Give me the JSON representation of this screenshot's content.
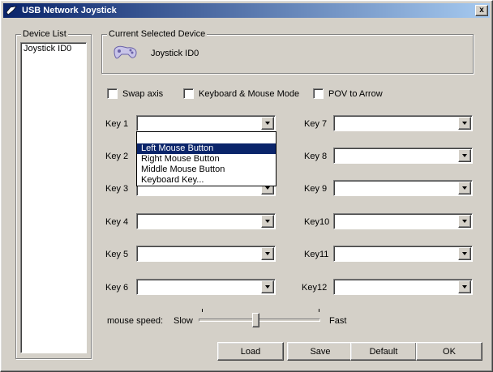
{
  "window": {
    "title": "USB Network Joystick",
    "close_glyph": "x"
  },
  "device_list": {
    "label": "Device List",
    "items": [
      "Joystick ID0"
    ]
  },
  "current_device": {
    "label": "Current Selected Device",
    "name": "Joystick ID0",
    "icon": "gamepad-icon"
  },
  "options": {
    "swap_axis": {
      "label": "Swap axis",
      "checked": false
    },
    "keyboard_mouse_mode": {
      "label": "Keyboard & Mouse Mode",
      "checked": false
    },
    "pov_to_arrow": {
      "label": "POV to Arrow",
      "checked": false
    }
  },
  "keys": {
    "k1": {
      "label": "Key 1",
      "value": ""
    },
    "k2": {
      "label": "Key 2",
      "value": ""
    },
    "k3": {
      "label": "Key 3",
      "value": ""
    },
    "k4": {
      "label": "Key 4",
      "value": ""
    },
    "k5": {
      "label": "Key 5",
      "value": ""
    },
    "k6": {
      "label": "Key 6",
      "value": ""
    },
    "k7": {
      "label": "Key 7",
      "value": ""
    },
    "k8": {
      "label": "Key 8",
      "value": ""
    },
    "k9": {
      "label": "Key 9",
      "value": ""
    },
    "k10": {
      "label": "Key10",
      "value": ""
    },
    "k11": {
      "label": "Key11",
      "value": ""
    },
    "k12": {
      "label": "Key12",
      "value": ""
    }
  },
  "dropdown": {
    "options": [
      "Left Mouse Button",
      "Right Mouse Button",
      "Middle Mouse Button",
      "Keyboard Key..."
    ],
    "highlighted": "Left Mouse Button"
  },
  "mouse_speed": {
    "label": "mouse speed:",
    "min_label": "Slow",
    "max_label": "Fast",
    "value_fraction": 0.47
  },
  "buttons": {
    "load": "Load",
    "save": "Save",
    "default": "Default",
    "ok": "OK"
  },
  "colors": {
    "face": "#d4d0c8",
    "title_start": "#0a246a",
    "title_end": "#a6caf0",
    "highlight": "#0a246a"
  }
}
